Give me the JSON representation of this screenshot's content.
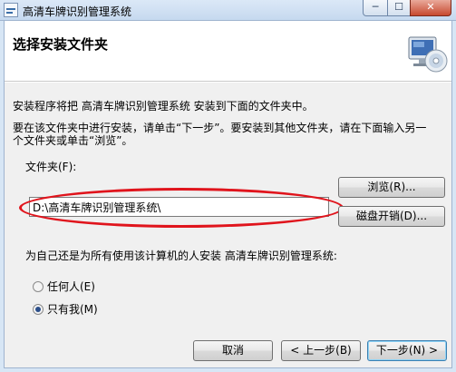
{
  "window": {
    "title": "高清车牌识别管理系统",
    "min_glyph": "─",
    "max_glyph": "☐",
    "close_glyph": "✕"
  },
  "header": {
    "title": "选择安装文件夹"
  },
  "body": {
    "intro": "安装程序将把 高清车牌识别管理系统 安装到下面的文件夹中。",
    "instruction_line1": "要在该文件夹中进行安装，请单击“下一步”。要安装到其他文件夹，请在下面输入另一",
    "instruction_line2": "个文件夹或单击“浏览”。"
  },
  "folder": {
    "label": "文件夹(F):",
    "value": "D:\\高清车牌识别管理系统\\"
  },
  "buttons": {
    "browse": "浏览(R)...",
    "disk_cost": "磁盘开销(D)...",
    "cancel": "取消",
    "back": "< 上一步(B)",
    "next": "下一步(N) >"
  },
  "install_for": {
    "question": "为自己还是为所有使用该计算机的人安装 高清车牌识别管理系统:",
    "options": [
      {
        "label": "任何人(E)",
        "selected": false
      },
      {
        "label": "只有我(M)",
        "selected": true
      }
    ]
  }
}
